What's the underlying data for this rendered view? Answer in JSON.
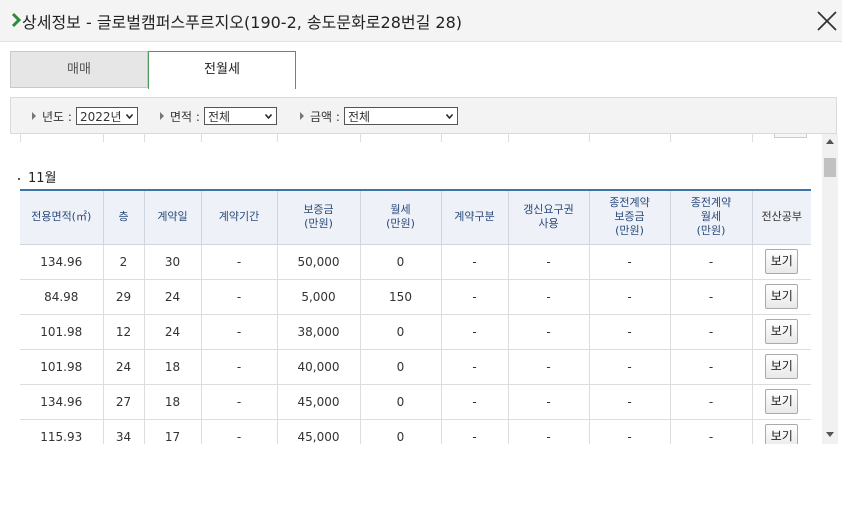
{
  "header": {
    "title": "상세정보 - 글로벌캠퍼스푸르지오(190-2, 송도문화로28번길 28)"
  },
  "tabs": [
    {
      "label": "매매",
      "active": false
    },
    {
      "label": "전월세",
      "active": true
    }
  ],
  "filters": {
    "year_label": "년도 :",
    "year_value": "2022년",
    "area_label": "면적 :",
    "area_value": "전체",
    "amount_label": "금액 :",
    "amount_value": "전체"
  },
  "month": "11월",
  "table": {
    "headers": [
      [
        "전용면적(㎡)"
      ],
      [
        "층"
      ],
      [
        "계약일"
      ],
      [
        "계약기간"
      ],
      [
        "보증금",
        "(만원)"
      ],
      [
        "월세",
        "(만원)"
      ],
      [
        "계약구분"
      ],
      [
        "갱신요구권",
        "사용"
      ],
      [
        "종전계약",
        "보증금",
        "(만원)"
      ],
      [
        "종전계약",
        "월세",
        "(만원)"
      ],
      [
        "전산공부"
      ]
    ],
    "view_label": "보기",
    "rows": [
      [
        "134.96",
        "2",
        "30",
        "-",
        "50,000",
        "0",
        "-",
        "-",
        "-",
        "-"
      ],
      [
        "84.98",
        "29",
        "24",
        "-",
        "5,000",
        "150",
        "-",
        "-",
        "-",
        "-"
      ],
      [
        "101.98",
        "12",
        "24",
        "-",
        "38,000",
        "0",
        "-",
        "-",
        "-",
        "-"
      ],
      [
        "101.98",
        "24",
        "18",
        "-",
        "40,000",
        "0",
        "-",
        "-",
        "-",
        "-"
      ],
      [
        "134.96",
        "27",
        "18",
        "-",
        "45,000",
        "0",
        "-",
        "-",
        "-",
        "-"
      ],
      [
        "115.93",
        "34",
        "17",
        "-",
        "45,000",
        "0",
        "-",
        "-",
        "-",
        "-"
      ]
    ]
  },
  "colors": {
    "accent_green": "#2e8b3a",
    "header_blue": "#3e74a8",
    "th_text": "#2a4a7a"
  }
}
